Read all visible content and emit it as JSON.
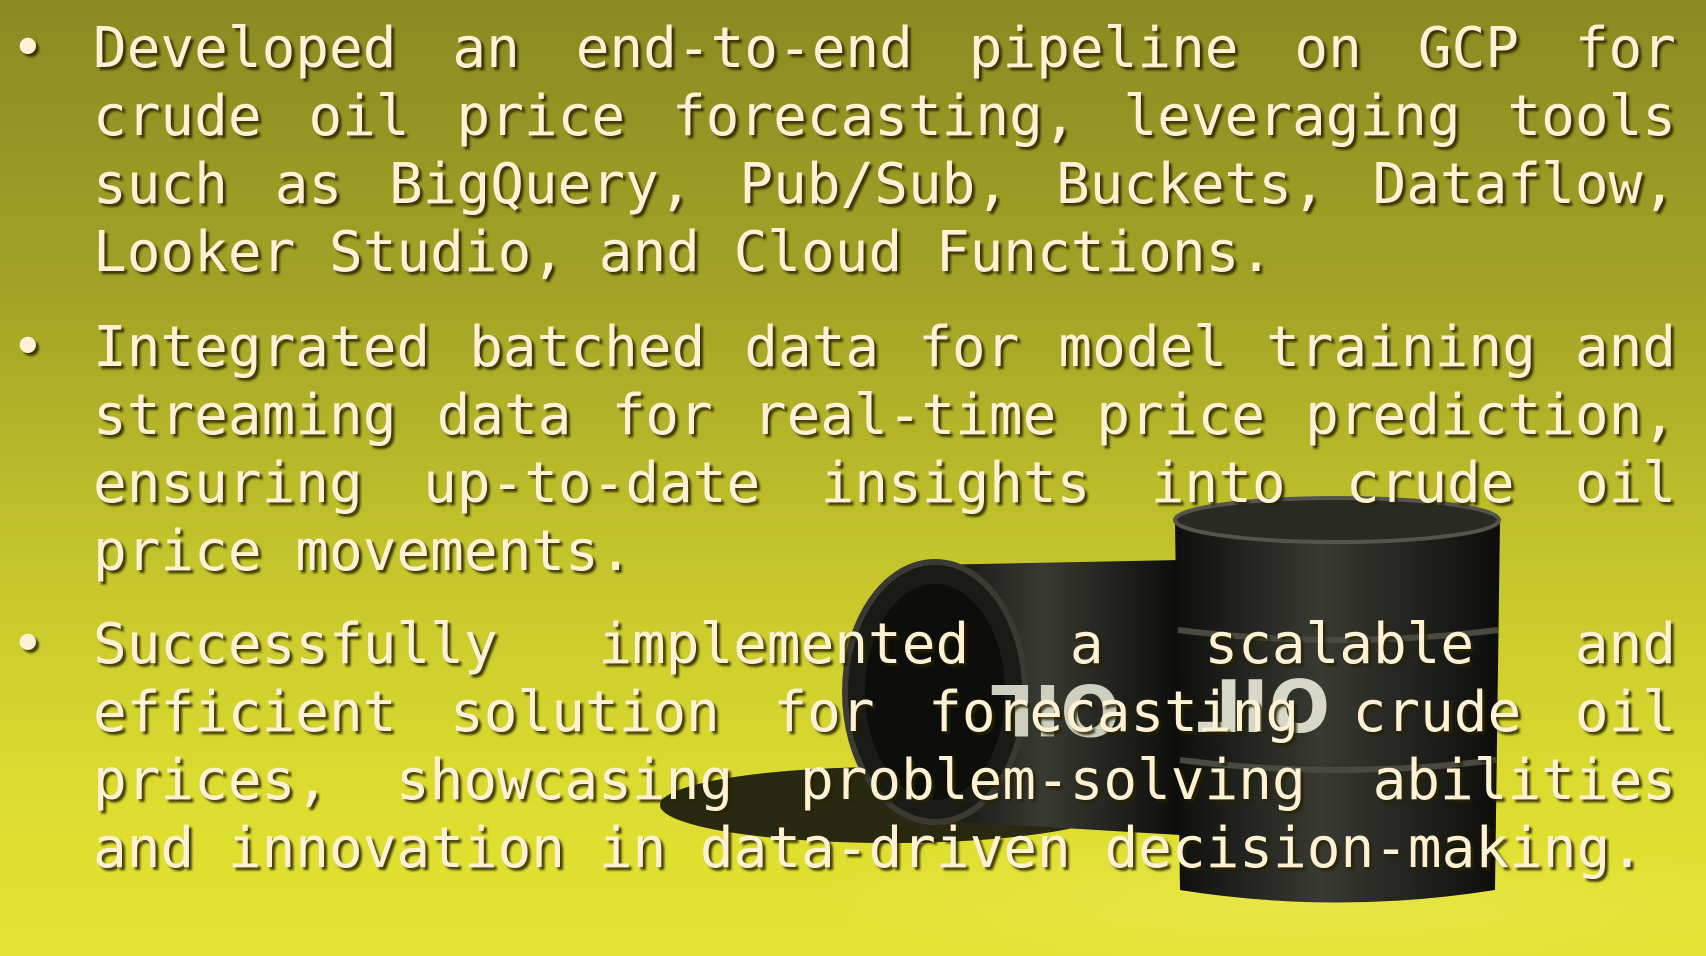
{
  "slide": {
    "bullet_char": "•",
    "bullets": [
      {
        "lines": [
          "Developed an end-to-end pipeline on GCP for",
          "crude oil price forecasting, leveraging tools",
          "such as BigQuery, Pub/Sub, Buckets, Dataflow,",
          "Looker Studio, and Cloud Functions."
        ]
      },
      {
        "lines": [
          "Integrated batched data for model training and",
          "streaming data for real-time price prediction,",
          "ensuring up-to-date insights into crude oil",
          "price movements."
        ]
      },
      {
        "lines": [
          "Successfully implemented a scalable and",
          "efficient solution for forecasting crude oil",
          "prices, showcasing problem-solving abilities",
          "and innovation in data-driven decision-making."
        ]
      }
    ],
    "image_label": "OIL",
    "colors": {
      "text": "#fff2d4",
      "background_top": "#8a8a22",
      "background_bottom": "#e4e232",
      "barrel": "#1e1e1a"
    }
  }
}
